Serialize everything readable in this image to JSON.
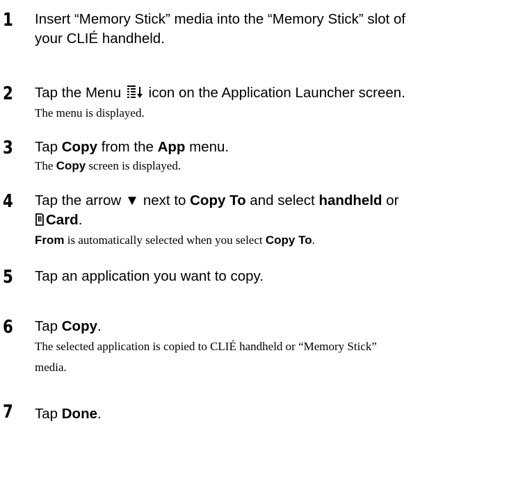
{
  "steps": [
    {
      "number": "1",
      "line1": "Insert “Memory Stick” media into the “Memory Stick” slot of",
      "line2": "your CLIÉ handheld."
    },
    {
      "number": "2",
      "text_a": "Tap the Menu",
      "icon": "menu-icon",
      "text_b": "icon on the Application Launcher screen.",
      "sub": "The menu is displayed."
    },
    {
      "number": "3",
      "text_a": "Tap ",
      "bold_a": "Copy",
      "text_b": " from the ",
      "bold_b": "App",
      "text_c": " menu.",
      "sub_a": "The ",
      "sub_bold": "Copy",
      "sub_b": " screen is displayed."
    },
    {
      "number": "4",
      "text_a": "Tap the arrow ▼ next to ",
      "bold_a": "Copy To",
      "text_b": " and select ",
      "bold_b": "handheld",
      "text_c": " or",
      "icon": "memory-stick-card-icon",
      "bold_c": "Card",
      "text_d": ".",
      "sub_bold_a": "From",
      "sub_a": " is automatically selected when you select ",
      "sub_bold_b": "Copy To",
      "sub_b": "."
    },
    {
      "number": "5",
      "text": "Tap an application you want to copy."
    },
    {
      "number": "6",
      "text_a": "Tap ",
      "bold_a": "Copy",
      "text_b": ".",
      "sub_line1": "The selected application is copied to CLIÉ handheld or “Memory Stick”",
      "sub_line2": "media."
    },
    {
      "number": "7",
      "text_a": "Tap ",
      "bold_a": "Done",
      "text_b": "."
    }
  ]
}
